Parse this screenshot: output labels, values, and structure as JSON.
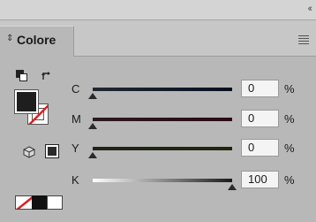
{
  "panel": {
    "collapse_icon": "double-chevron-left",
    "tab_icon": "up-down-arrows",
    "tab_label": "Colore",
    "menu_icon": "hamburger-menu"
  },
  "tools": {
    "default_colors_icon": "default-fill-stroke",
    "swap_icon": "swap-arrow",
    "fill_color": "#1e1e1e",
    "stroke_color": "#ffffff",
    "out_of_gamut_icon": "cube",
    "web_safe_icon": "small-black-square"
  },
  "sliders": [
    {
      "label": "C",
      "value": "0",
      "unit": "%",
      "level": 0,
      "gradient": [
        "#1f2733",
        "#061020"
      ]
    },
    {
      "label": "M",
      "value": "0",
      "unit": "%",
      "level": 0,
      "gradient": [
        "#2a1a1e",
        "#2a0a15"
      ]
    },
    {
      "label": "Y",
      "value": "0",
      "unit": "%",
      "level": 0,
      "gradient": [
        "#1f2418",
        "#20260e"
      ]
    },
    {
      "label": "K",
      "value": "100",
      "unit": "%",
      "level": 1,
      "gradient": [
        "#ffffff",
        "#1a1a1a"
      ]
    }
  ],
  "footer": {
    "swatches": [
      "none",
      "black",
      "white"
    ]
  }
}
